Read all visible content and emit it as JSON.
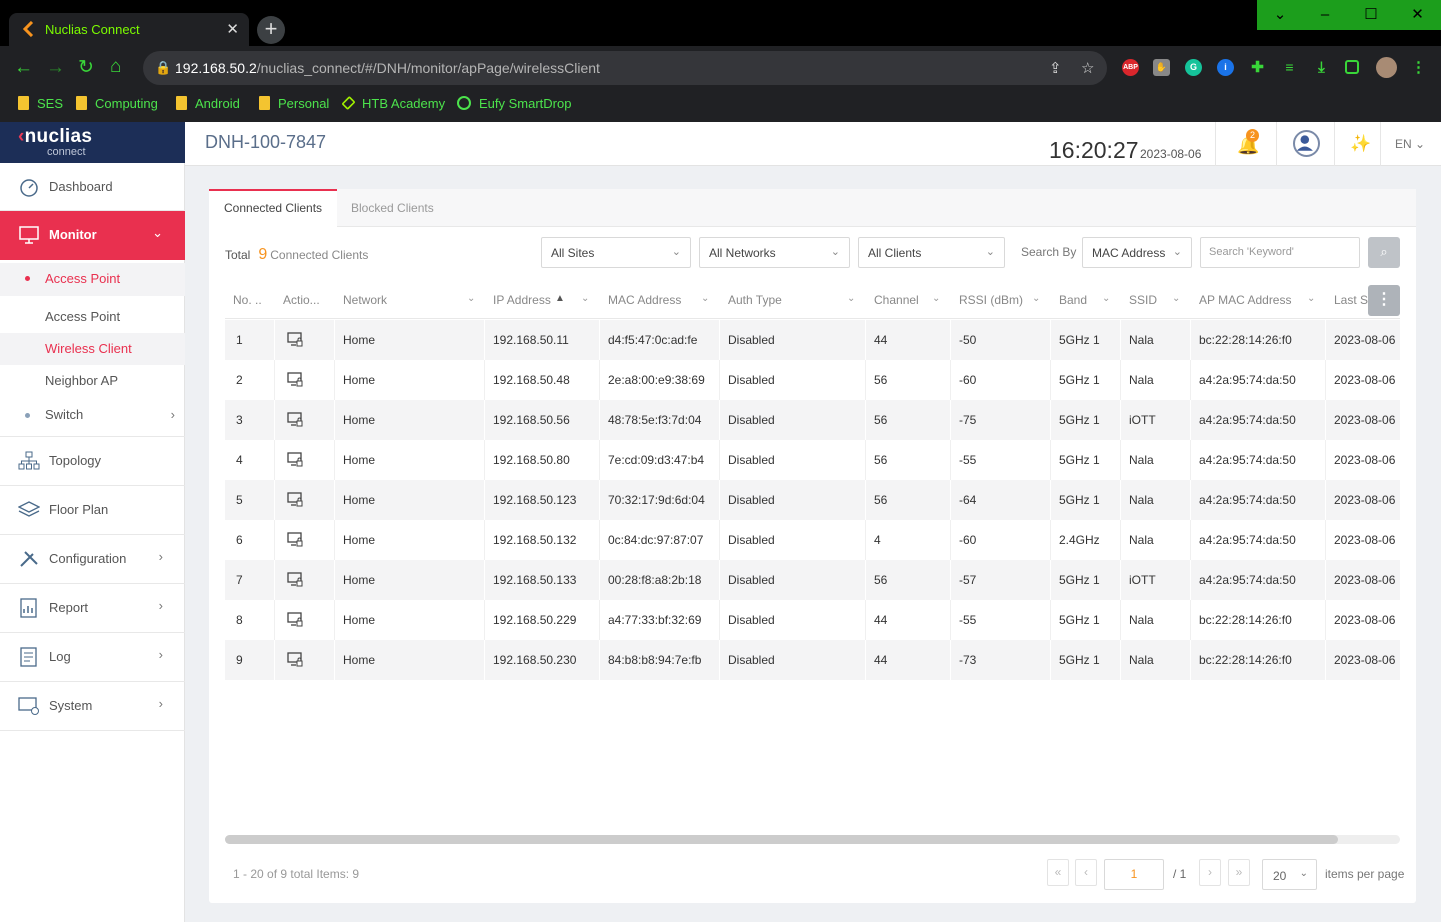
{
  "browser": {
    "tab_title": "Nuclias Connect",
    "url_host": "192.168.50.2",
    "url_path": "/nuclias_connect/#/DNH/monitor/apPage/wirelessClient",
    "bookmarks": [
      "SES",
      "Computing",
      "Android",
      "Personal",
      "HTB Academy",
      "Eufy SmartDrop"
    ],
    "ext_abp": "ABP"
  },
  "logo": {
    "brand": "nuclias",
    "sub": "connect"
  },
  "sidebar": {
    "dashboard": "Dashboard",
    "monitor": "Monitor",
    "access_point_group": "Access Point",
    "access_point": "Access Point",
    "wireless_client": "Wireless Client",
    "neighbor_ap": "Neighbor AP",
    "switch": "Switch",
    "topology": "Topology",
    "floor_plan": "Floor Plan",
    "configuration": "Configuration",
    "report": "Report",
    "log": "Log",
    "system": "System"
  },
  "header": {
    "device": "DNH-100-7847",
    "time": "16:20:27",
    "date": "2023-08-06",
    "notif_count": "2",
    "lang": "EN"
  },
  "tabs": {
    "connected": "Connected Clients",
    "blocked": "Blocked Clients"
  },
  "filters": {
    "total_label": "Total",
    "total_count": "9",
    "total_suffix": "Connected Clients",
    "sites": "All Sites",
    "networks": "All Networks",
    "clients": "All Clients",
    "search_by_label": "Search By",
    "search_by": "MAC Address",
    "keyword_placeholder": "Search 'Keyword'"
  },
  "columns": [
    "No. ..",
    "Actio...",
    "Network",
    "IP Address",
    "MAC Address",
    "Auth Type",
    "Channel",
    "RSSI (dBm)",
    "Band",
    "SSID",
    "AP MAC Address",
    "Last Se"
  ],
  "rows": [
    [
      "1",
      "Home",
      "192.168.50.11",
      "d4:f5:47:0c:ad:fe",
      "Disabled",
      "44",
      "-50",
      "5GHz 1",
      "Nala",
      "bc:22:28:14:26:f0",
      "2023-08-06"
    ],
    [
      "2",
      "Home",
      "192.168.50.48",
      "2e:a8:00:e9:38:69",
      "Disabled",
      "56",
      "-60",
      "5GHz 1",
      "Nala",
      "a4:2a:95:74:da:50",
      "2023-08-06"
    ],
    [
      "3",
      "Home",
      "192.168.50.56",
      "48:78:5e:f3:7d:04",
      "Disabled",
      "56",
      "-75",
      "5GHz 1",
      "iOTT",
      "a4:2a:95:74:da:50",
      "2023-08-06"
    ],
    [
      "4",
      "Home",
      "192.168.50.80",
      "7e:cd:09:d3:47:b4",
      "Disabled",
      "56",
      "-55",
      "5GHz 1",
      "Nala",
      "a4:2a:95:74:da:50",
      "2023-08-06"
    ],
    [
      "5",
      "Home",
      "192.168.50.123",
      "70:32:17:9d:6d:04",
      "Disabled",
      "56",
      "-64",
      "5GHz 1",
      "Nala",
      "a4:2a:95:74:da:50",
      "2023-08-06"
    ],
    [
      "6",
      "Home",
      "192.168.50.132",
      "0c:84:dc:97:87:07",
      "Disabled",
      "4",
      "-60",
      "2.4GHz",
      "Nala",
      "a4:2a:95:74:da:50",
      "2023-08-06"
    ],
    [
      "7",
      "Home",
      "192.168.50.133",
      "00:28:f8:a8:2b:18",
      "Disabled",
      "56",
      "-57",
      "5GHz 1",
      "iOTT",
      "a4:2a:95:74:da:50",
      "2023-08-06"
    ],
    [
      "8",
      "Home",
      "192.168.50.229",
      "a4:77:33:bf:32:69",
      "Disabled",
      "44",
      "-55",
      "5GHz 1",
      "Nala",
      "bc:22:28:14:26:f0",
      "2023-08-06"
    ],
    [
      "9",
      "Home",
      "192.168.50.230",
      "84:b8:b8:94:7e:fb",
      "Disabled",
      "44",
      "-73",
      "5GHz 1",
      "Nala",
      "bc:22:28:14:26:f0",
      "2023-08-06"
    ]
  ],
  "pagination": {
    "info": "1 - 20 of 9  total Items: 9",
    "page": "1",
    "of": "/ 1",
    "page_size": "20",
    "per_page_label": "items per page"
  },
  "colors": {
    "accent": "#e9304f",
    "orange": "#f7931e",
    "navy": "#1c2e57"
  }
}
